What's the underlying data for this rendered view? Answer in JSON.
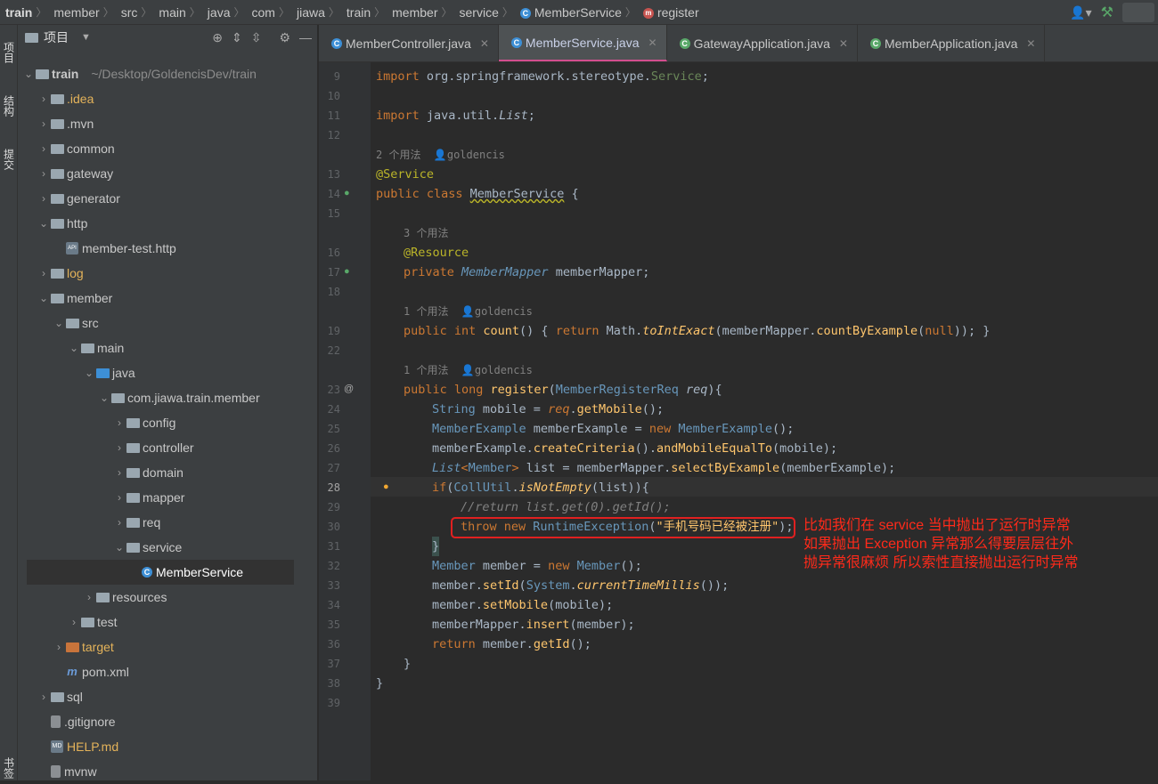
{
  "breadcrumb": {
    "items": [
      "train",
      "member",
      "src",
      "main",
      "java",
      "com",
      "jiawa",
      "train",
      "member",
      "service",
      "MemberService",
      "register"
    ]
  },
  "left_strip": {
    "tabs": [
      "项目",
      "结构",
      "提交",
      "书签"
    ]
  },
  "project": {
    "title": "项目",
    "tree": [
      {
        "label": "train",
        "extra": "~/Desktop/GoldencisDev/train",
        "arrow": "v",
        "icon": "folder"
      },
      {
        "label": ".idea",
        "arrow": ">",
        "icon": "folder",
        "color": "#e4b35a"
      },
      {
        "label": ".mvn",
        "arrow": ">",
        "icon": "folder"
      },
      {
        "label": "common",
        "arrow": ">",
        "icon": "folder"
      },
      {
        "label": "gateway",
        "arrow": ">",
        "icon": "folder"
      },
      {
        "label": "generator",
        "arrow": ">",
        "icon": "folder"
      },
      {
        "label": "http",
        "arrow": "v",
        "icon": "folder"
      },
      {
        "label": "member-test.http",
        "arrow": "",
        "icon": "api"
      },
      {
        "label": "log",
        "arrow": ">",
        "icon": "folder",
        "color": "#e4b35a"
      },
      {
        "label": "member",
        "arrow": "v",
        "icon": "folder"
      },
      {
        "label": "src",
        "arrow": "v",
        "icon": "folder"
      },
      {
        "label": "main",
        "arrow": "v",
        "icon": "folder"
      },
      {
        "label": "java",
        "arrow": "v",
        "icon": "folder-blue"
      },
      {
        "label": "com.jiawa.train.member",
        "arrow": "v",
        "icon": "folder"
      },
      {
        "label": "config",
        "arrow": ">",
        "icon": "folder"
      },
      {
        "label": "controller",
        "arrow": ">",
        "icon": "folder"
      },
      {
        "label": "domain",
        "arrow": ">",
        "icon": "folder"
      },
      {
        "label": "mapper",
        "arrow": ">",
        "icon": "folder"
      },
      {
        "label": "req",
        "arrow": ">",
        "icon": "folder"
      },
      {
        "label": "service",
        "arrow": "v",
        "icon": "folder"
      },
      {
        "label": "MemberService",
        "arrow": "",
        "icon": "class",
        "selected": true
      },
      {
        "label": "resources",
        "arrow": ">",
        "icon": "folder"
      },
      {
        "label": "test",
        "arrow": ">",
        "icon": "folder"
      },
      {
        "label": "target",
        "arrow": ">",
        "icon": "folder-orange",
        "color": "#e4b35a"
      },
      {
        "label": "pom.xml",
        "arrow": "",
        "icon": "maven"
      },
      {
        "label": "sql",
        "arrow": ">",
        "icon": "folder"
      },
      {
        "label": ".gitignore",
        "arrow": "",
        "icon": "file"
      },
      {
        "label": "HELP.md",
        "arrow": "",
        "icon": "md",
        "color": "#e4b35a"
      },
      {
        "label": "mvnw",
        "arrow": "",
        "icon": "file"
      }
    ]
  },
  "tabs": [
    {
      "label": "MemberController.java",
      "active": false
    },
    {
      "label": "MemberService.java",
      "active": true
    },
    {
      "label": "GatewayApplication.java",
      "active": false
    },
    {
      "label": "MemberApplication.java",
      "active": false
    }
  ],
  "code": {
    "line_numbers": [
      "9",
      "10",
      "11",
      "12",
      "13",
      "14",
      "15",
      "16",
      "17",
      "18",
      "19",
      "22",
      "23",
      "24",
      "25",
      "26",
      "27",
      "28",
      "29",
      "30",
      "31",
      "32",
      "33",
      "34",
      "35",
      "36",
      "37",
      "38",
      "39"
    ],
    "hints": {
      "h1_count": "2 个用法",
      "h1_author": "goldencis",
      "h2_count": "3 个用法",
      "h3_count": "1 个用法",
      "h3_author": "goldencis",
      "h4_count": "1 个用法",
      "h4_author": "goldencis"
    },
    "l9": {
      "kw": "import ",
      "pkg": "org.springframework.stereotype.",
      "cls": "Service",
      ";": ";"
    },
    "l11": {
      "kw": "import ",
      "pkg": "java.util.",
      "cls": "List",
      ";": ";"
    },
    "l13": "@Service",
    "l14": {
      "kw": "public class ",
      "name": "MemberService",
      "rest": " {"
    },
    "l16": "@Resource",
    "l17": {
      "kw": "private ",
      "type": "MemberMapper",
      "rest": " memberMapper;"
    },
    "l19": {
      "kw1": "public int ",
      "fn": "count",
      "p1": "() { ",
      "kw2": "return ",
      "t1": "Math",
      "dot": ".",
      "m1": "toIntExact",
      "p2": "(memberMapper.",
      "m2": "countByExample",
      "p3": "(",
      "kw3": "null",
      "p4": ")); }"
    },
    "l23": {
      "kw": "public long ",
      "fn": "register",
      "p1": "(",
      "t1": "MemberRegisterReq",
      "sp": " ",
      "arg": "req",
      "p2": "){"
    },
    "l24": {
      "t": "String",
      "a": " mobile = ",
      "v": "req",
      "b": ".",
      "m": "getMobile",
      "c": "();"
    },
    "l25": {
      "t": "MemberExample",
      "a": " memberExample = ",
      "kw": "new ",
      "t2": "MemberExample",
      "c": "();"
    },
    "l26": {
      "a": "memberExample.",
      "m1": "createCriteria",
      "b": "().",
      "m2": "andMobileEqualTo",
      "c": "(mobile);"
    },
    "l27": {
      "t": "List",
      "lt": "<",
      "t2": "Member",
      "gt": ">",
      "a": " list = memberMapper.",
      "m": "selectByExample",
      "c": "(memberExample);"
    },
    "l28": {
      "kw": "if",
      "p1": "(",
      "t": "CollUtil",
      "d": ".",
      "m": "isNotEmpty",
      "p2": "(list)){"
    },
    "l29": "//return list.get(0).getId();",
    "l30": {
      "kw1": "throw ",
      "kw2": "new ",
      "t": "RuntimeException",
      "p1": "(",
      "s": "\"手机号码已经被注册\"",
      "p2": ");"
    },
    "l31": "}",
    "l32": {
      "t": "Member",
      "a": " member = ",
      "kw": "new ",
      "t2": "Member",
      "c": "();"
    },
    "l33": {
      "a": "member.",
      "m": "setId",
      "p1": "(",
      "t": "System",
      "d": ".",
      "m2": "currentTimeMillis",
      "p2": "());"
    },
    "l34": {
      "a": "member.",
      "m": "setMobile",
      "c": "(mobile);"
    },
    "l35": {
      "a": "memberMapper.",
      "m": "insert",
      "c": "(member);"
    },
    "l36": {
      "kw": "return ",
      "a": "member.",
      "m": "getId",
      "c": "();"
    },
    "l37": "}",
    "l38": "}"
  },
  "annotation": {
    "lines": [
      "比如我们在 service 当中抛出了运行时异常",
      "如果抛出 Exception 异常那么得要层层往外",
      "抛异常很麻烦 所以索性直接抛出运行时异常"
    ]
  },
  "colors": {
    "annotation": "#e02020",
    "active_tab_underline": "#d34e8e"
  }
}
